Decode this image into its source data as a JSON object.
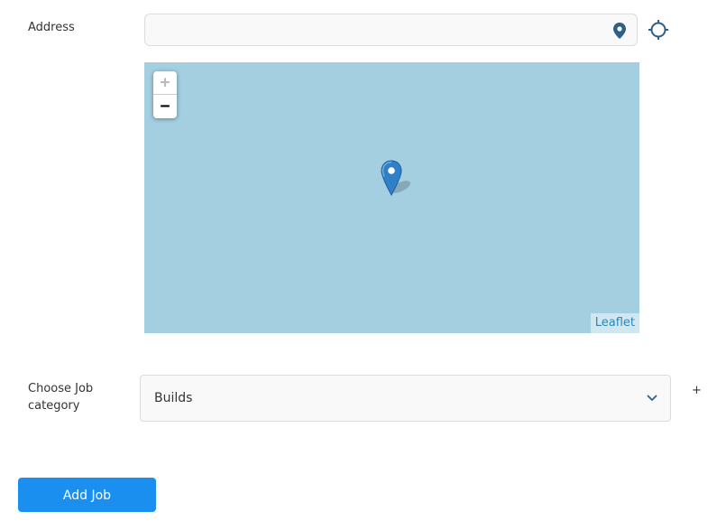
{
  "form": {
    "address_label": "Address",
    "address_value": "",
    "address_placeholder": "",
    "address_pin_icon": "map-pin-icon",
    "locate_icon": "crosshair-icon",
    "category_label": "Choose Job category",
    "category_value": "Builds",
    "category_chevron_icon": "chevron-down-icon",
    "add_category_label": "+",
    "submit_label": "Add Job"
  },
  "map": {
    "zoom_in_label": "+",
    "zoom_out_label": "−",
    "zoom_in_enabled": false,
    "attribution": "Leaflet",
    "marker_icon": "map-marker-icon",
    "water_color": "#a3cfe0"
  },
  "colors": {
    "accent": "#1a8ff0",
    "pin": "#2c5f8a",
    "marker": "#2f7fc9"
  }
}
